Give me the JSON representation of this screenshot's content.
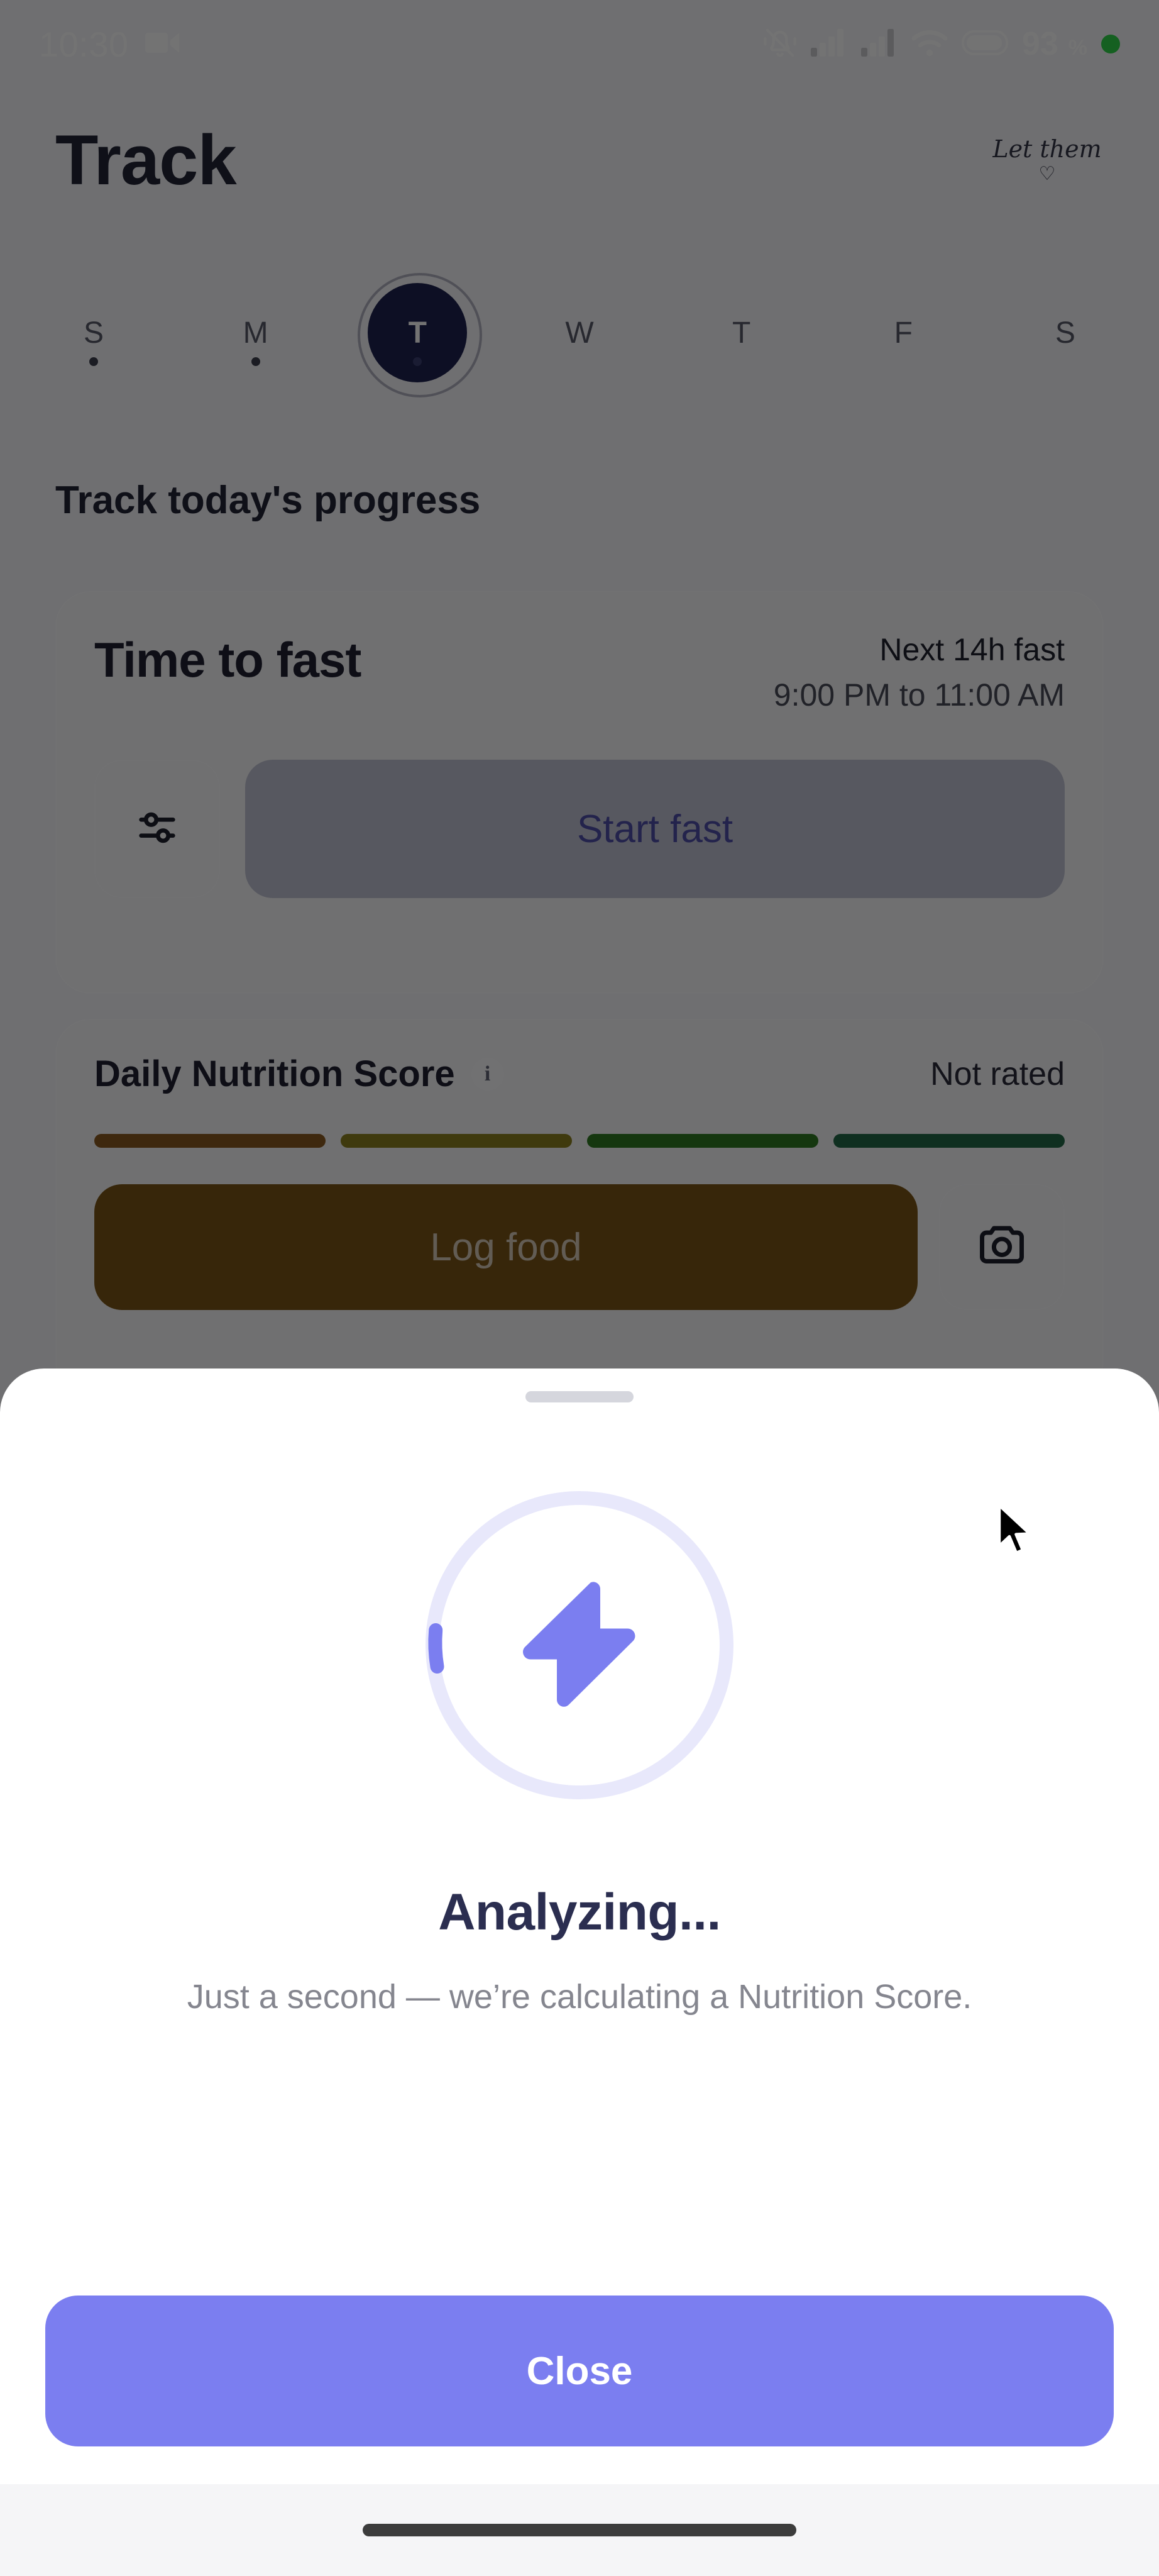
{
  "status_bar": {
    "time": "10:30",
    "recording_icon": "video-camera-icon",
    "icons": [
      "bell-muted-icon",
      "signal-bars-icon",
      "signal-bars-icon",
      "wifi-icon",
      "battery-icon"
    ],
    "battery_percent": "93",
    "percent_symbol": "%",
    "indicator_dot_color": "#2fd44b"
  },
  "header": {
    "title": "Track",
    "brand_mark": "Let them",
    "brand_heart": "♡"
  },
  "day_strip": {
    "days": [
      {
        "label": "S",
        "selected": false,
        "dot": true
      },
      {
        "label": "M",
        "selected": false,
        "dot": true
      },
      {
        "label": "T",
        "selected": true,
        "dot": true
      },
      {
        "label": "W",
        "selected": false,
        "dot": false
      },
      {
        "label": "T",
        "selected": false,
        "dot": false
      },
      {
        "label": "F",
        "selected": false,
        "dot": false
      },
      {
        "label": "S",
        "selected": false,
        "dot": false
      }
    ]
  },
  "section": {
    "heading": "Track today's progress"
  },
  "fast_card": {
    "title": "Time to fast",
    "next_label": "Next 14h fast",
    "window": "9:00 PM to 11:00 AM",
    "settings_icon": "sliders-icon",
    "start_label": "Start fast"
  },
  "nutrition_card": {
    "title": "Daily Nutrition Score",
    "info_icon": "info-icon",
    "info_glyph": "i",
    "status": "Not rated",
    "score_bars": [
      {
        "color": "#8a5a20"
      },
      {
        "color": "#8c8121"
      },
      {
        "color": "#2f7a22"
      },
      {
        "color": "#236848"
      }
    ],
    "log_food_label": "Log food",
    "log_food_color": "#7a5418",
    "camera_icon": "camera-icon"
  },
  "sheet": {
    "handle": "drag-handle",
    "spinner": {
      "icon": "lightning-bolt-icon",
      "track_color": "#e8e8fb",
      "arc_color": "#7b7ef0",
      "bolt_color": "#7b7ef0"
    },
    "title": "Analyzing...",
    "description": "Just a second — we’re calculating a Nutrition Score.",
    "close_label": "Close",
    "close_color": "#7b7ef0"
  },
  "system": {
    "home_indicator": "home-indicator",
    "cursor": "mouse-pointer"
  }
}
